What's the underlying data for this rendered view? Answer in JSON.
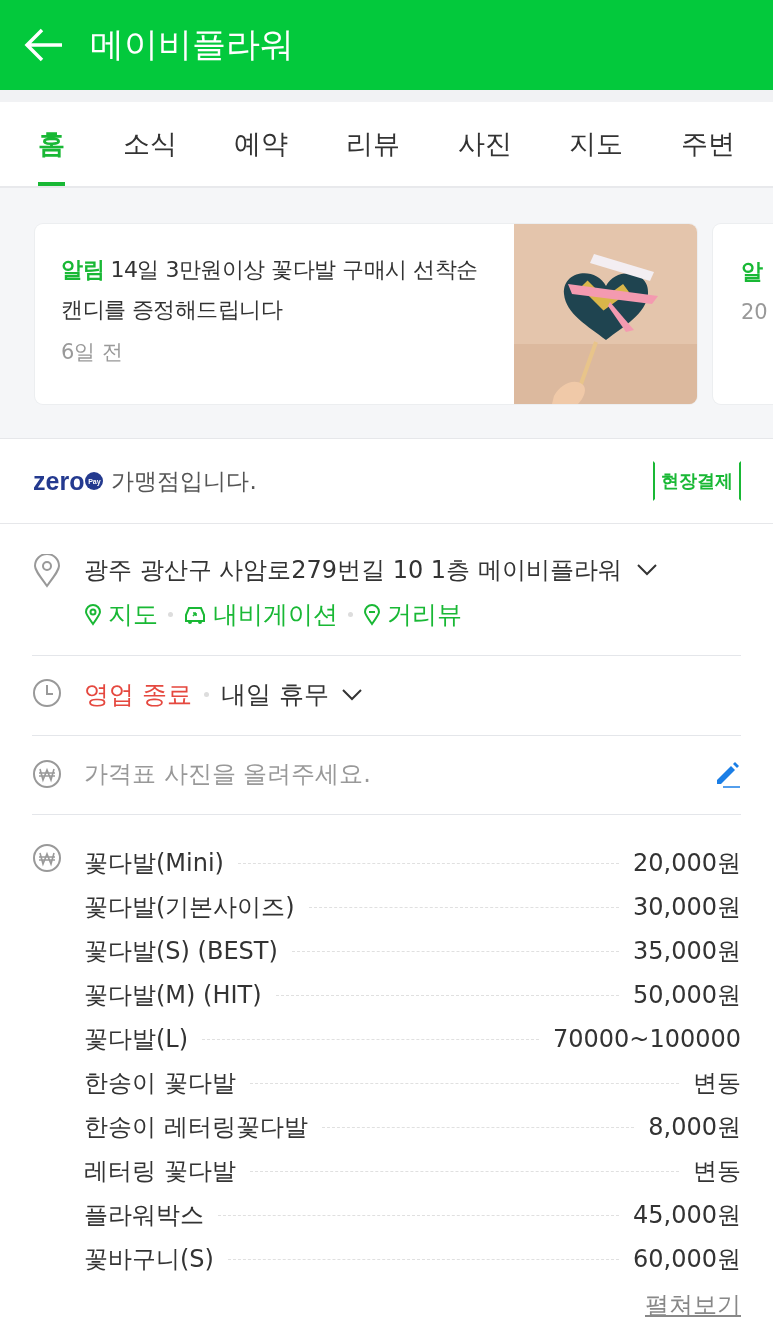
{
  "header": {
    "title": "메이비플라워"
  },
  "tabs": [
    {
      "label": "홈",
      "selected": true
    },
    {
      "label": "소식",
      "selected": false
    },
    {
      "label": "예약",
      "selected": false
    },
    {
      "label": "리뷰",
      "selected": false
    },
    {
      "label": "사진",
      "selected": false
    },
    {
      "label": "지도",
      "selected": false
    },
    {
      "label": "주변",
      "selected": false
    }
  ],
  "notices": [
    {
      "tag": "알림",
      "text": "14일 3만원이상 꽃다발 구매시 선착순 캔디를 증정해드립니다",
      "time": "6일 전"
    },
    {
      "tag": "알",
      "time": "20"
    }
  ],
  "zeropay": {
    "logo": "zero",
    "logo_badge": "Pay",
    "text": "가맹점입니다.",
    "badge": "현장결제"
  },
  "address": {
    "text": "광주 광산구 사암로279번길 10 1층 메이비플라워",
    "links": [
      "지도",
      "내비게이션",
      "거리뷰"
    ]
  },
  "hours": {
    "status": "영업 종료",
    "detail": "내일 휴무"
  },
  "price_photo": {
    "placeholder": "가격표 사진을 올려주세요."
  },
  "prices": [
    {
      "name": "꽃다발(Mini)",
      "price": "20,000원"
    },
    {
      "name": "꽃다발(기본사이즈)",
      "price": "30,000원"
    },
    {
      "name": "꽃다발(S) (BEST)",
      "price": "35,000원"
    },
    {
      "name": "꽃다발(M) (HIT)",
      "price": "50,000원"
    },
    {
      "name": "꽃다발(L)",
      "price": "70000~100000"
    },
    {
      "name": "한송이 꽃다발",
      "price": "변동"
    },
    {
      "name": "한송이 레터링꽃다발",
      "price": "8,000원"
    },
    {
      "name": "레터링 꽃다발",
      "price": "변동"
    },
    {
      "name": "플라워박스",
      "price": "45,000원"
    },
    {
      "name": "꽃바구니(S)",
      "price": "60,000원"
    }
  ],
  "more_link": "펼쳐보기"
}
